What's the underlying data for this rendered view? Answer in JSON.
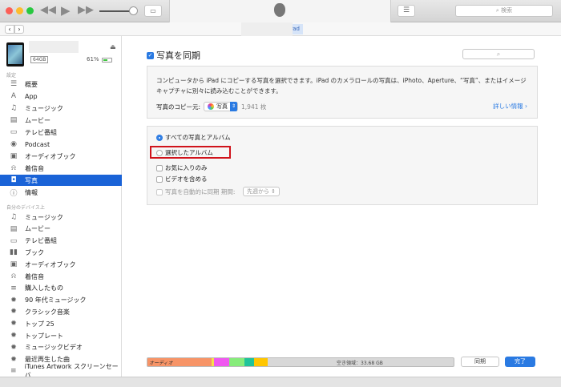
{
  "toolbar": {
    "search_placeholder": "検索",
    "device_tab": "iPad"
  },
  "device": {
    "capacity": "64GB",
    "battery": "61%"
  },
  "sidebar": {
    "settings_header": "設定",
    "settings_items": [
      {
        "label": "概要",
        "icon": "summary-icon"
      },
      {
        "label": "App",
        "icon": "app-icon"
      },
      {
        "label": "ミュージック",
        "icon": "music-icon"
      },
      {
        "label": "ムービー",
        "icon": "movie-icon"
      },
      {
        "label": "テレビ番組",
        "icon": "tv-icon"
      },
      {
        "label": "Podcast",
        "icon": "podcast-icon"
      },
      {
        "label": "オーディオブック",
        "icon": "audiobook-icon"
      },
      {
        "label": "着信音",
        "icon": "bell-icon"
      },
      {
        "label": "写真",
        "icon": "camera-icon",
        "selected": true
      },
      {
        "label": "情報",
        "icon": "info-icon"
      }
    ],
    "device_header": "自分のデバイス上",
    "device_items": [
      {
        "label": "ミュージック",
        "icon": "music-icon"
      },
      {
        "label": "ムービー",
        "icon": "movie-icon"
      },
      {
        "label": "テレビ番組",
        "icon": "tv-icon"
      },
      {
        "label": "ブック",
        "icon": "book-icon"
      },
      {
        "label": "オーディオブック",
        "icon": "audiobook-icon"
      },
      {
        "label": "着信音",
        "icon": "bell-icon"
      },
      {
        "label": "購入したもの",
        "icon": "playlist-icon"
      },
      {
        "label": "90 年代ミュージック",
        "icon": "gear-icon"
      },
      {
        "label": "クラシック音楽",
        "icon": "gear-icon"
      },
      {
        "label": "トップ 25",
        "icon": "gear-icon"
      },
      {
        "label": "トップレート",
        "icon": "gear-icon"
      },
      {
        "label": "ミュージックビデオ",
        "icon": "gear-icon"
      },
      {
        "label": "最近再生した曲",
        "icon": "gear-icon"
      },
      {
        "label": "iTunes Artwork スクリーンセーバ",
        "icon": "playlist-icon"
      }
    ]
  },
  "main": {
    "sync_title": "写真を同期",
    "description": "コンピュータから iPad にコピーする写真を選択できます。iPad のカメラロールの写真は、iPhoto、Aperture、“写真”、またはイメージキャプチャに別々に読み込むことができます。",
    "copy_from_label": "写真のコピー元:",
    "copy_from_value": "写真",
    "photo_count": "1,941 枚",
    "more_info": "詳しい情報",
    "option_all": "すべての写真とアルバム",
    "option_selected": "選択したアルバム",
    "favorites_only": "お気に入りのみ",
    "include_videos": "ビデオを含める",
    "auto_sync": "写真を自動的に同期 期間:",
    "period_value": "先週から"
  },
  "storage": {
    "audio_label": "オーディオ",
    "free_label": "空き領域：33.68 GB",
    "segments": [
      {
        "color": "#f79467"
      },
      {
        "color": "#f5e04a"
      },
      {
        "color": "#f058f0"
      },
      {
        "color": "#86ec7a"
      },
      {
        "color": "#20c39a"
      },
      {
        "color": "#ffc600"
      }
    ]
  },
  "buttons": {
    "sync": "同期",
    "done": "完了"
  }
}
